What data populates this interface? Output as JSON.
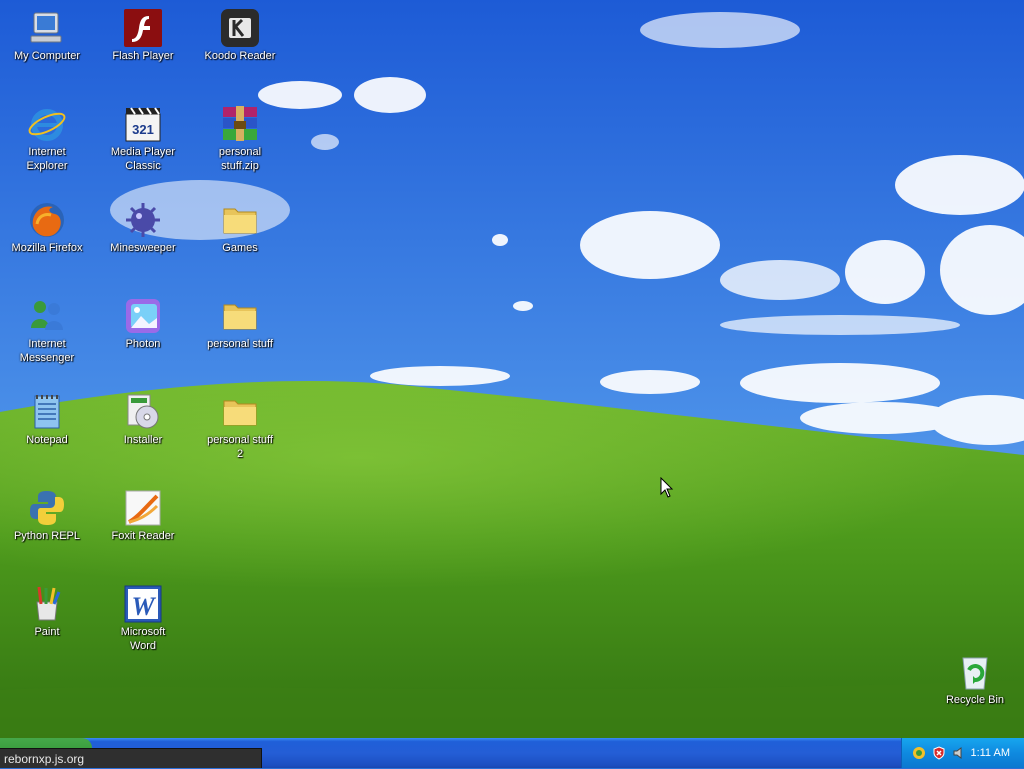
{
  "desktop": {
    "icons": [
      {
        "label": "My Computer",
        "icon": "my-computer-icon"
      },
      {
        "label": "Flash Player",
        "icon": "flash-player-icon"
      },
      {
        "label": "Koodo Reader",
        "icon": "koodo-reader-icon"
      },
      {
        "label": "Internet\nExplorer",
        "icon": "internet-explorer-icon"
      },
      {
        "label": "Media Player\nClassic",
        "icon": "media-player-classic-icon"
      },
      {
        "label": "personal\nstuff.zip",
        "icon": "zip-archive-icon"
      },
      {
        "label": "Mozilla Firefox",
        "icon": "firefox-icon"
      },
      {
        "label": "Minesweeper",
        "icon": "minesweeper-icon"
      },
      {
        "label": "Games",
        "icon": "folder-icon"
      },
      {
        "label": "Internet\nMessenger",
        "icon": "messenger-icon"
      },
      {
        "label": "Photon",
        "icon": "photon-icon"
      },
      {
        "label": "personal stuff",
        "icon": "folder-icon"
      },
      {
        "label": "Notepad",
        "icon": "notepad-icon"
      },
      {
        "label": "Installer",
        "icon": "installer-icon"
      },
      {
        "label": "personal stuff\n2",
        "icon": "folder-icon"
      },
      {
        "label": "Python REPL",
        "icon": "python-icon"
      },
      {
        "label": "Foxit Reader",
        "icon": "foxit-reader-icon"
      },
      {
        "label": "Paint",
        "icon": "paint-icon"
      },
      {
        "label": "Microsoft\nWord",
        "icon": "word-icon"
      },
      {
        "label": "Recycle Bin",
        "icon": "recycle-bin-icon"
      }
    ]
  },
  "taskbar": {
    "clock": "1:11 AM",
    "tray_icons": [
      "network-icon",
      "security-alert-icon",
      "volume-icon"
    ]
  },
  "status_tip": "rebornxp.js.org",
  "colors": {
    "sky_top": "#1f5ed6",
    "grass": "#4f9a1e",
    "taskbar_blue": "#245ed6",
    "tray_blue": "#0f8ae0",
    "start_green": "#379a3a"
  }
}
